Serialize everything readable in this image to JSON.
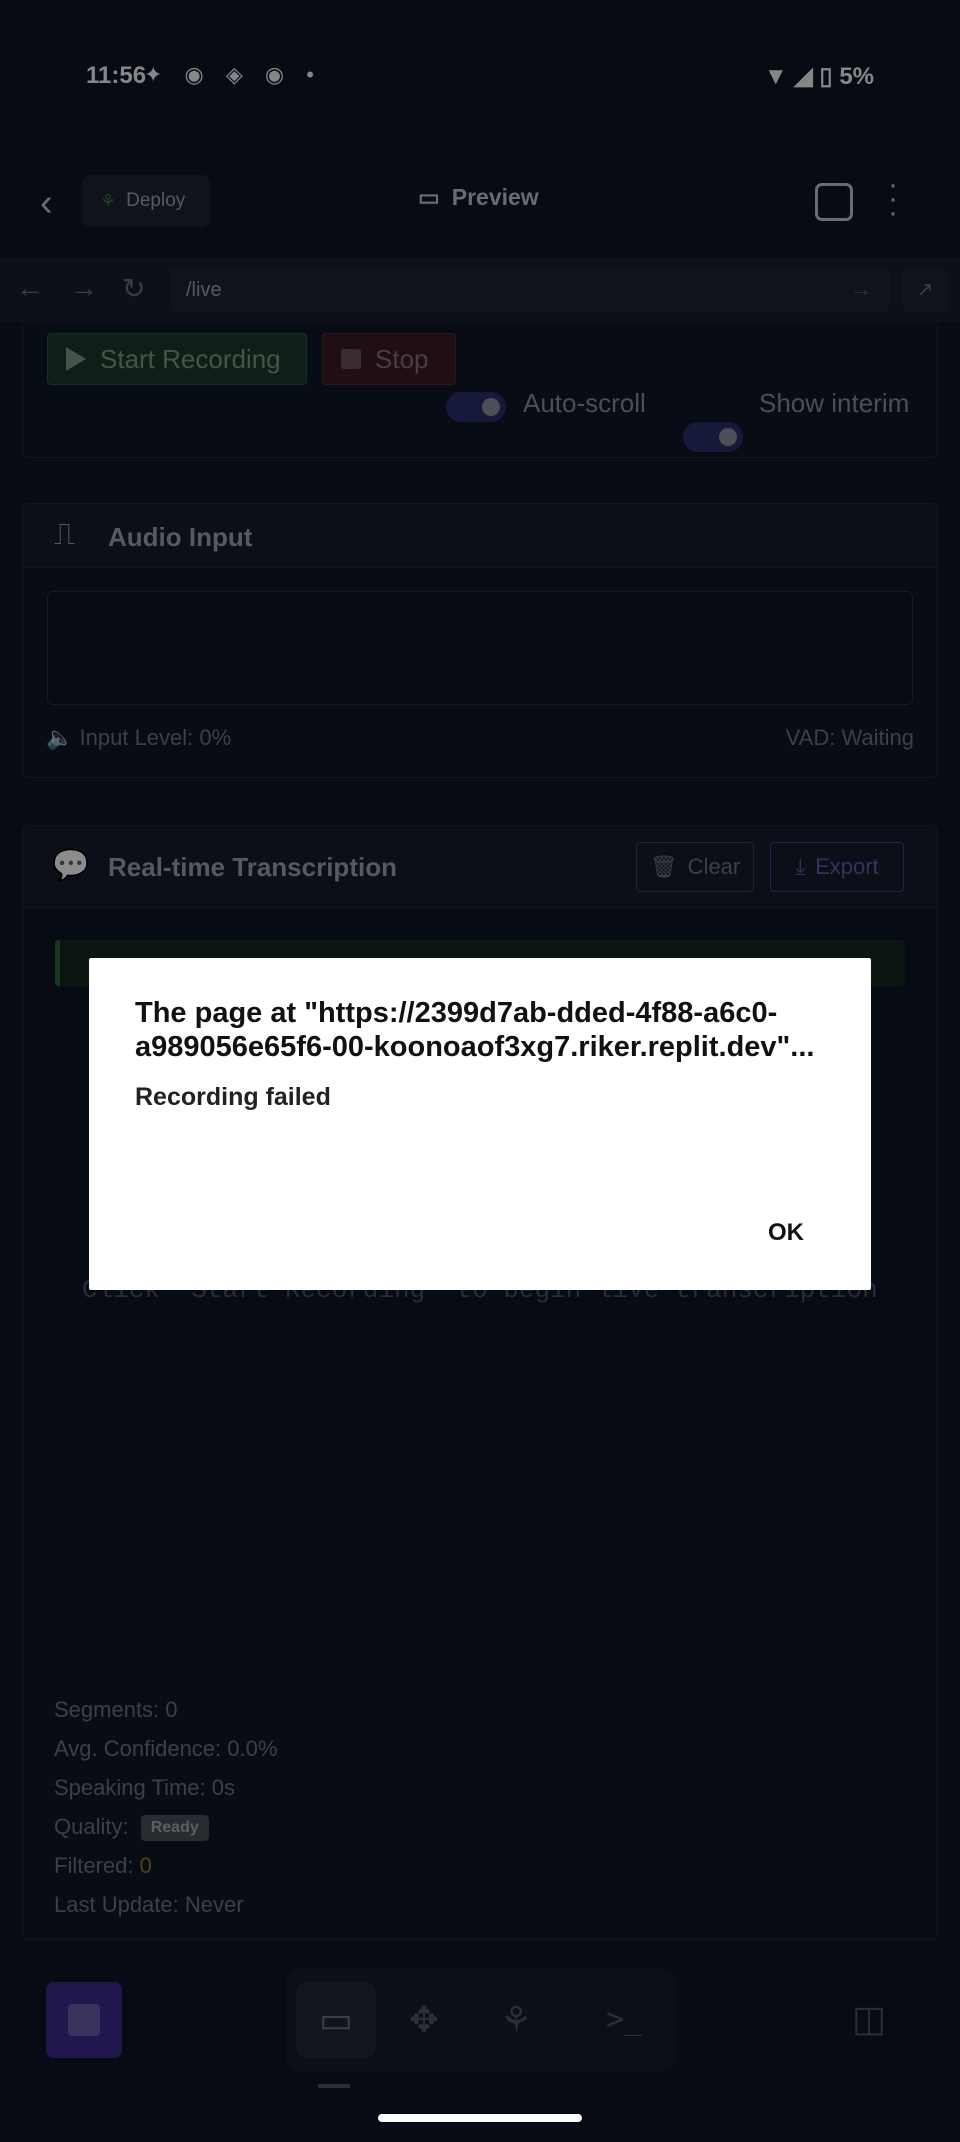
{
  "status_bar": {
    "time": "11:56",
    "icons": "✦ ◉ ◈ ◉ •",
    "battery": "5%"
  },
  "header": {
    "deploy_label": "Deploy",
    "preview_label": "Preview"
  },
  "urlbar": {
    "path": "/live"
  },
  "controls": {
    "start_label": "Start Recording",
    "stop_label": "Stop",
    "autoscroll_label": "Auto-scroll",
    "interim_label": "Show interim"
  },
  "audio": {
    "title": "Audio Input",
    "input_level": "Input Level: 0%",
    "vad": "VAD: Waiting"
  },
  "transcription": {
    "title": "Real-time Transcription",
    "clear_label": "Clear",
    "export_label": "Export",
    "placeholder": "Click \"Start Recording\" to begin live transcription"
  },
  "stats": {
    "segments": "Segments: 0",
    "confidence": "Avg. Confidence: 0.0%",
    "speaking_time": "Speaking Time: 0s",
    "quality_label": "Quality:",
    "quality_badge": "Ready",
    "filtered_label": "Filtered:",
    "filtered_value": "0",
    "last_update": "Last Update: Never"
  },
  "dialog": {
    "title": "The page at \"https://2399d7ab-dded-4f88-a6c0-a989056e65f6-00-koonoaof3xg7.riker.replit.dev\"...",
    "message": "Recording failed",
    "ok_label": "OK"
  },
  "colors": {
    "accent": "#3d2a8a",
    "dialog_bg": "#ffffff",
    "filtered_value": "#8a7a2a"
  }
}
